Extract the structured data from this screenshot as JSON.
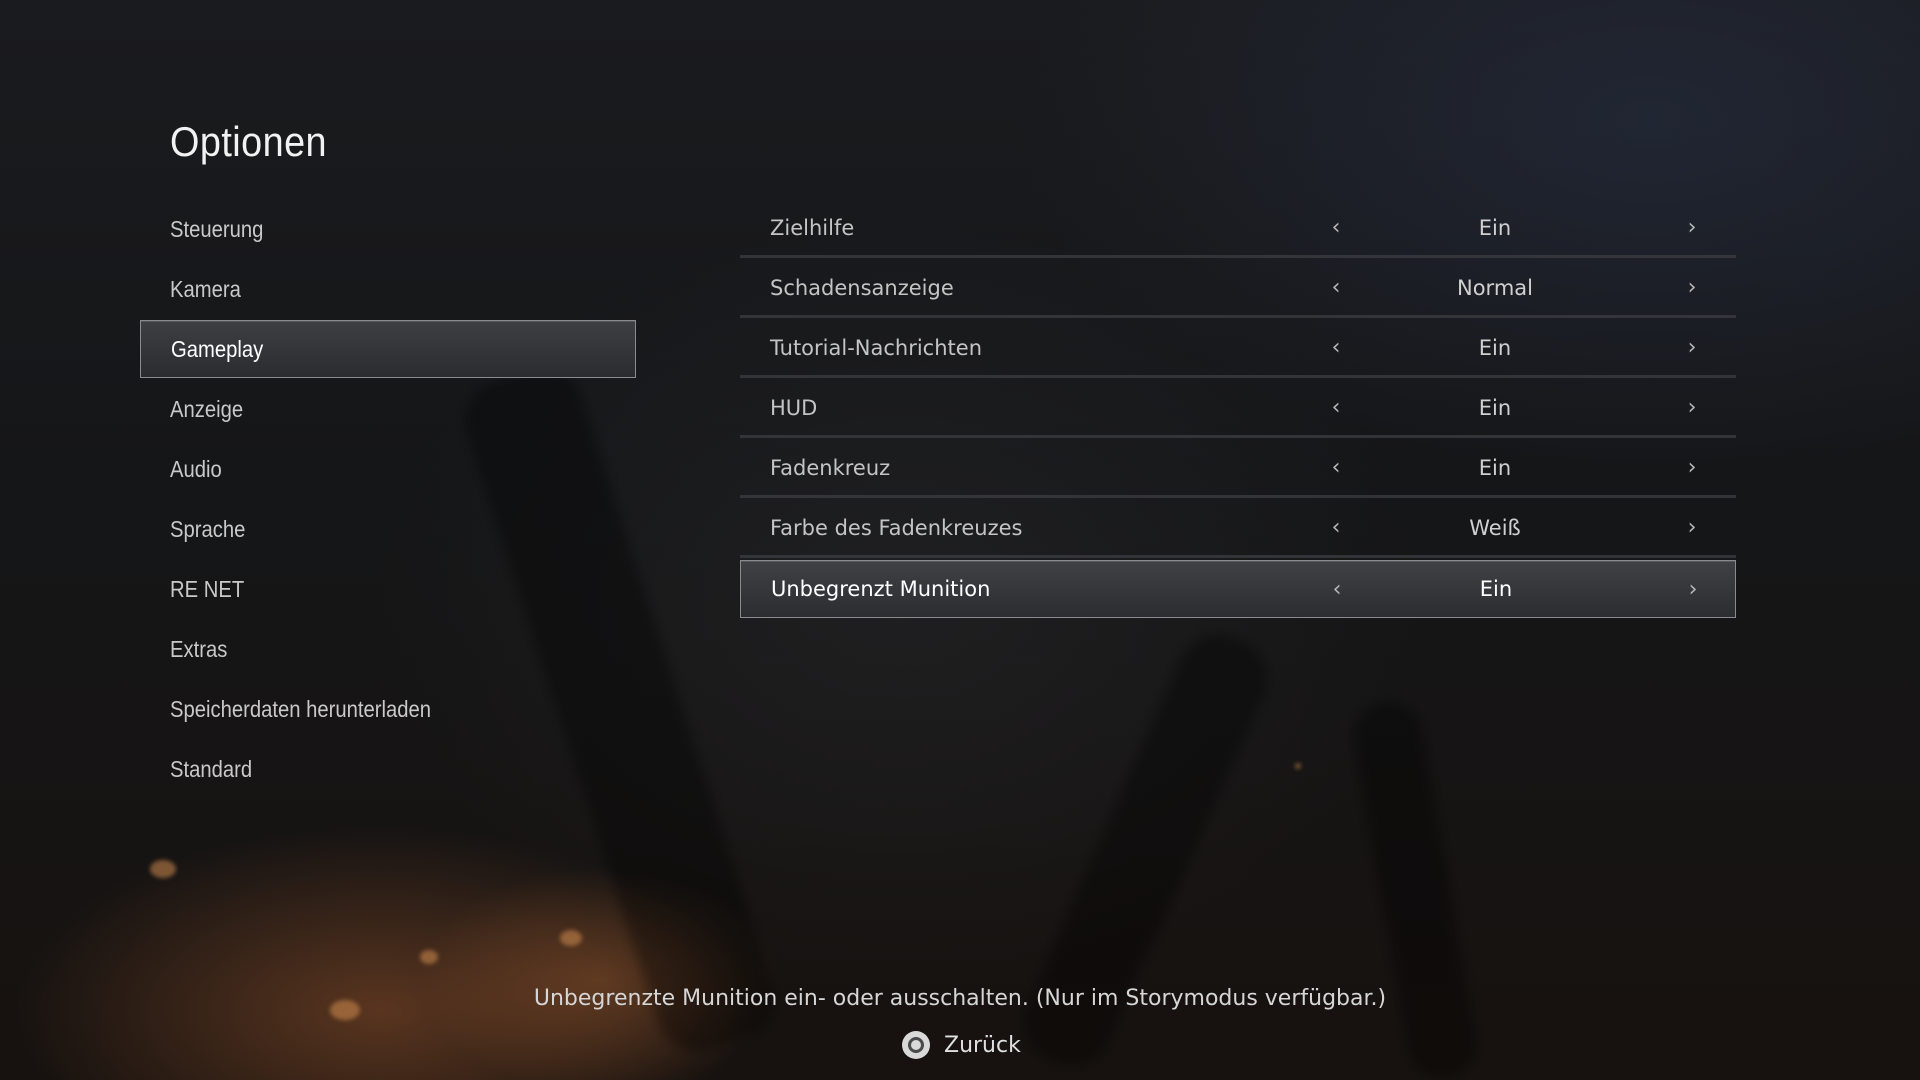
{
  "page": {
    "title": "Optionen"
  },
  "categories": [
    {
      "label": "Steuerung",
      "selected": false
    },
    {
      "label": "Kamera",
      "selected": false
    },
    {
      "label": "Gameplay",
      "selected": true
    },
    {
      "label": "Anzeige",
      "selected": false
    },
    {
      "label": "Audio",
      "selected": false
    },
    {
      "label": "Sprache",
      "selected": false
    },
    {
      "label": "RE NET",
      "selected": false
    },
    {
      "label": "Extras",
      "selected": false
    },
    {
      "label": "Speicherdaten herunterladen",
      "selected": false
    },
    {
      "label": "Standard",
      "selected": false
    }
  ],
  "settings": [
    {
      "label": "Zielhilfe",
      "value": "Ein",
      "selected": false
    },
    {
      "label": "Schadensanzeige",
      "value": "Normal",
      "selected": false
    },
    {
      "label": "Tutorial-Nachrichten",
      "value": "Ein",
      "selected": false
    },
    {
      "label": "HUD",
      "value": "Ein",
      "selected": false
    },
    {
      "label": "Fadenkreuz",
      "value": "Ein",
      "selected": false
    },
    {
      "label": "Farbe des Fadenkreuzes",
      "value": "Weiß",
      "selected": false
    },
    {
      "label": "Unbegrenzt Munition",
      "value": "Ein",
      "selected": true
    }
  ],
  "arrows": {
    "left": "‹",
    "right": "›"
  },
  "footer": {
    "description": "Unbegrenzte Munition ein- oder ausschalten. (Nur im Storymodus verfügbar.)",
    "back_label": "Zurück",
    "back_icon": "circle-button-icon"
  },
  "colors": {
    "selection_border": "#8a8b8f",
    "selection_fill": "#3a3b3f",
    "text_primary": "#ffffff",
    "text_secondary": "#c4c4c4"
  }
}
